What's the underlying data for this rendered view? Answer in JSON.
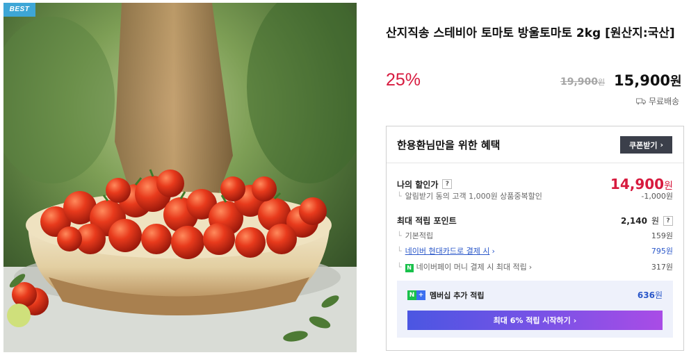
{
  "badge": "BEST",
  "product": {
    "title": "산지직송 스테비아 토마토 방울토마토 2kg [원산지:국산]",
    "discount": "25%",
    "original_price": "19,900",
    "original_won": "원",
    "sale_price": "15,900",
    "sale_won": "원",
    "shipping": "무료배송"
  },
  "benefit": {
    "title": "한용환님만을 위한 혜택",
    "coupon_label": "쿠폰받기",
    "my_price_label": "나의 할인가",
    "help": "?",
    "my_price": "14,900",
    "my_price_won": "원",
    "alarm_label": "알림받기 동의 고객 1,000원 상품중복할인",
    "alarm_amount": "-1,000원",
    "point_label": "최대 적립 포인트",
    "point_total": "2,140",
    "point_won": "원",
    "point_rows": [
      {
        "label": "기본적립",
        "amount": "159원"
      },
      {
        "label": "네이버 현대카드로 결제 시",
        "amount": "795원"
      },
      {
        "label": "네이버페이 머니 결제 시 최대 적립",
        "amount": "317원"
      }
    ],
    "membership": {
      "label": "멤버십 추가 적립",
      "amount": "636",
      "won": "원",
      "button": "최대 6% 적립 시작하기"
    }
  },
  "icons": {
    "chevron": "chevron-right-icon",
    "shipping": "truck-icon",
    "npay": "npay-icon"
  }
}
